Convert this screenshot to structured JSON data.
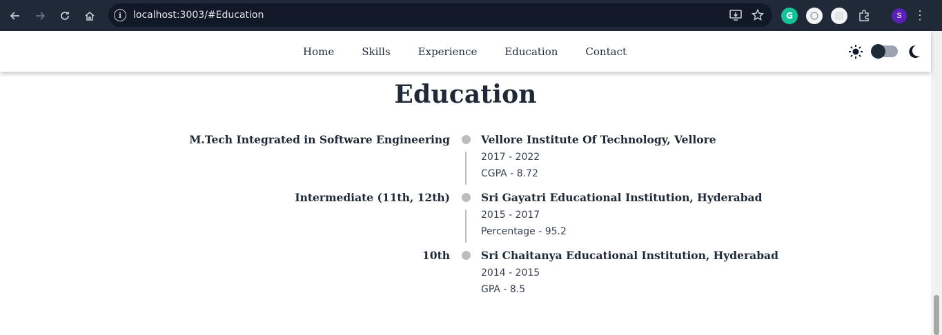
{
  "browser": {
    "url": "localhost:3003/#Education",
    "profile_initial": "S",
    "grammarly_letter": "G"
  },
  "nav": {
    "links": [
      "Home",
      "Skills",
      "Experience",
      "Education",
      "Contact"
    ]
  },
  "theme": {
    "mode": "dark-toggle-off"
  },
  "section": {
    "title": "Education",
    "entries": [
      {
        "degree": "M.Tech Integrated in Software Engineering",
        "institution": "Vellore Institute Of Technology, Vellore",
        "years": "2017 - 2022",
        "score": "CGPA - 8.72"
      },
      {
        "degree": "Intermediate (11th, 12th)",
        "institution": "Sri Gayatri Educational Institution, Hyderabad",
        "years": "2015 - 2017",
        "score": "Percentage - 95.2"
      },
      {
        "degree": "10th",
        "institution": "Sri Chaitanya Educational Institution, Hyderabad",
        "years": "2014 - 2015",
        "score": "GPA - 8.5"
      }
    ]
  }
}
